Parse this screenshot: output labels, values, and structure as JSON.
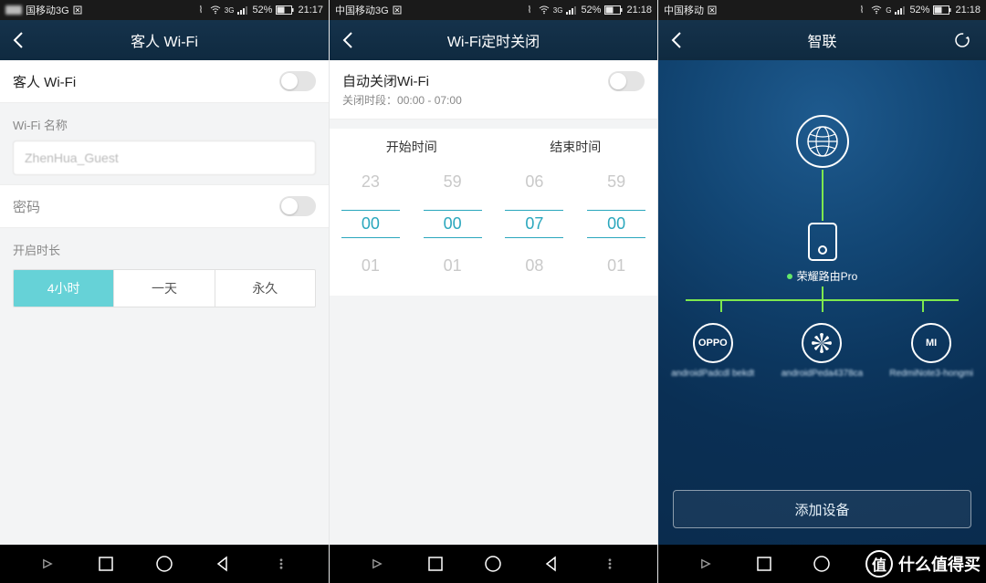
{
  "watermark": "什么值得买",
  "panel1": {
    "status": {
      "carrier": "国移动3G",
      "battery": "52%",
      "time": "21:17",
      "net": "3G"
    },
    "header": {
      "title": "客人 Wi-Fi"
    },
    "guest_row": {
      "label": "客人 Wi-Fi"
    },
    "name_section": "Wi-Fi 名称",
    "name_value": "ZhenHua_Guest",
    "password_label": "密码",
    "duration_label": "开启时长",
    "segments": {
      "s0": "4小时",
      "s1": "一天",
      "s2": "永久"
    }
  },
  "panel2": {
    "status": {
      "carrier": "中国移动3G",
      "battery": "52%",
      "time": "21:18",
      "net": "3G"
    },
    "header": {
      "title": "Wi-Fi定时关闭"
    },
    "auto_row": {
      "label": "自动关闭Wi-Fi",
      "sub_prefix": "关闭时段：",
      "sub_range": "00:00 - 07:00"
    },
    "tp": {
      "start_label": "开始时间",
      "end_label": "结束时间",
      "start_h": {
        "prev": "23",
        "sel": "00",
        "next": "01"
      },
      "start_m": {
        "prev": "59",
        "sel": "00",
        "next": "01"
      },
      "end_h": {
        "prev": "06",
        "sel": "07",
        "next": "08"
      },
      "end_m": {
        "prev": "59",
        "sel": "00",
        "next": "01"
      }
    }
  },
  "panel3": {
    "status": {
      "carrier": "中国移动",
      "battery": "52%",
      "time": "21:18",
      "net": "G"
    },
    "header": {
      "title": "智联"
    },
    "router_name": "荣耀路由Pro",
    "devices": {
      "d0": {
        "badge": "OPPO",
        "name": "androidPadcdl bekdt"
      },
      "d1": {
        "badge": "",
        "name": "androidPeda4378ca"
      },
      "d2": {
        "badge": "MI",
        "name": "RedmiNote3-hongmi"
      }
    },
    "add_button": "添加设备"
  }
}
